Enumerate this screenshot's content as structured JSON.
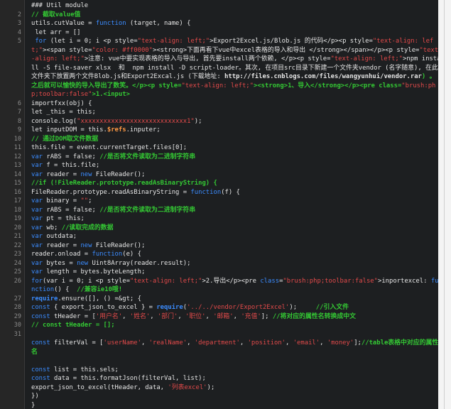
{
  "editor": {
    "lines": [
      {
        "n": "",
        "tokens": [
          {
            "t": "### Util module",
            "c": "plain"
          }
        ]
      },
      {
        "n": "2",
        "tokens": [
          {
            "t": "// 截取value值",
            "c": "com"
          }
        ]
      },
      {
        "n": "3",
        "tokens": [
          {
            "t": "utils.cutValue = ",
            "c": "plain"
          },
          {
            "t": "function",
            "c": "kw"
          },
          {
            "t": " (target, name) {",
            "c": "plain"
          }
        ]
      },
      {
        "n": "4",
        "tokens": [
          {
            "t": " let arr = []",
            "c": "plain"
          }
        ]
      },
      {
        "n": "5",
        "tokens": [
          {
            "t": " for",
            "c": "kw"
          },
          {
            "t": " (let i = 0; i <p style=",
            "c": "plain"
          },
          {
            "t": "\"text-align: left;\"",
            "c": "str"
          },
          {
            "t": ">Export2Excel.js/Blob.js 的代码</p><p style=",
            "c": "plain"
          },
          {
            "t": "\"text-align: left;\"",
            "c": "str"
          },
          {
            "t": "><span style=",
            "c": "plain"
          },
          {
            "t": "\"color: #ff0000\"",
            "c": "str"
          },
          {
            "t": "><strong>下面再看下vue中excel表格的导入和导出 </strong></span></p><p style=",
            "c": "plain"
          },
          {
            "t": "\"text-align: left;\"",
            "c": "str"
          },
          {
            "t": ">注意: vue中要实现表格的导入与导出, 首先要install两个依赖, </p><p style=",
            "c": "plain"
          },
          {
            "t": "\"text-align: left;\"",
            "c": "str"
          },
          {
            "t": ">npm install -S file-saver xlsx  和  npm install -D script-loader。其次, 在项目src目录下新建一个文件夹vendor (名字随意), 在此文件夹下放置两个文件Blob.js和Export2Excal.js (下载地址: ",
            "c": "plain"
          },
          {
            "t": "http://files.cnblogs.com/files/wangyunhui/vendor.rar",
            "c": "link"
          },
          {
            "t": ") 。之后就可以愉快的导入导出了数笑。</p><p style=",
            "c": "com"
          },
          {
            "t": "\"text-align: left;\"",
            "c": "str"
          },
          {
            "t": "><strong>1、导入</strong></p><pre class=",
            "c": "com"
          },
          {
            "t": "\"brush:php;toolbar:false\"",
            "c": "str"
          },
          {
            "t": ">1.<input>",
            "c": "com"
          }
        ]
      },
      {
        "n": "6",
        "tokens": [
          {
            "t": "importfxx(obj) {",
            "c": "plain"
          }
        ]
      },
      {
        "n": "7",
        "tokens": [
          {
            "t": "let _this = this;",
            "c": "plain"
          }
        ]
      },
      {
        "n": "8",
        "tokens": [
          {
            "t": "console.log(",
            "c": "plain"
          },
          {
            "t": "\"xxxxxxxxxxxxxxxxxxxxxxxxxxxx1\"",
            "c": "str"
          },
          {
            "t": ");",
            "c": "plain"
          }
        ]
      },
      {
        "n": "9",
        "tokens": [
          {
            "t": "let inputDOM = this.",
            "c": "plain"
          },
          {
            "t": "$refs",
            "c": "orange"
          },
          {
            "t": ".inputer;",
            "c": "plain"
          }
        ]
      },
      {
        "n": "10",
        "tokens": [
          {
            "t": "// 通过DOM取文件数据",
            "c": "com"
          }
        ]
      },
      {
        "n": "11",
        "tokens": [
          {
            "t": "this.file = event.currentTarget.files[0];",
            "c": "plain"
          }
        ]
      },
      {
        "n": "12",
        "tokens": [
          {
            "t": "var",
            "c": "kw"
          },
          {
            "t": " rABS = false; ",
            "c": "plain"
          },
          {
            "t": "//是否将文件读取为二进制字符串",
            "c": "com"
          }
        ]
      },
      {
        "n": "13",
        "tokens": [
          {
            "t": "var",
            "c": "kw"
          },
          {
            "t": " f = this.file;",
            "c": "plain"
          }
        ]
      },
      {
        "n": "14",
        "tokens": [
          {
            "t": "var",
            "c": "kw"
          },
          {
            "t": " reader = ",
            "c": "plain"
          },
          {
            "t": "new",
            "c": "kw"
          },
          {
            "t": " FileReader();",
            "c": "plain"
          }
        ]
      },
      {
        "n": "15",
        "tokens": [
          {
            "t": "//if (!FileReader.prototype.readAsBinaryString) {",
            "c": "com"
          }
        ]
      },
      {
        "n": "16",
        "tokens": [
          {
            "t": "FileReader.prototype.readAsBinaryString = ",
            "c": "plain"
          },
          {
            "t": "function",
            "c": "kw"
          },
          {
            "t": "(f) {",
            "c": "plain"
          }
        ]
      },
      {
        "n": "17",
        "tokens": [
          {
            "t": "var",
            "c": "kw"
          },
          {
            "t": " binary = ",
            "c": "plain"
          },
          {
            "t": "\"\"",
            "c": "str"
          },
          {
            "t": ";",
            "c": "plain"
          }
        ]
      },
      {
        "n": "18",
        "tokens": [
          {
            "t": "var",
            "c": "kw"
          },
          {
            "t": " rABS = false; ",
            "c": "plain"
          },
          {
            "t": "//是否将文件读取为二进制字符串",
            "c": "com"
          }
        ]
      },
      {
        "n": "19",
        "tokens": [
          {
            "t": "var",
            "c": "kw"
          },
          {
            "t": " pt = this;",
            "c": "plain"
          }
        ]
      },
      {
        "n": "20",
        "tokens": [
          {
            "t": "var",
            "c": "kw"
          },
          {
            "t": " wb; ",
            "c": "plain"
          },
          {
            "t": "//读取完成的数据",
            "c": "com"
          }
        ]
      },
      {
        "n": "21",
        "tokens": [
          {
            "t": "var",
            "c": "kw"
          },
          {
            "t": " outdata;",
            "c": "plain"
          }
        ]
      },
      {
        "n": "22",
        "tokens": [
          {
            "t": "var",
            "c": "kw"
          },
          {
            "t": " reader = ",
            "c": "plain"
          },
          {
            "t": "new",
            "c": "kw"
          },
          {
            "t": " FileReader();",
            "c": "plain"
          }
        ]
      },
      {
        "n": "23",
        "tokens": [
          {
            "t": "reader.onload = ",
            "c": "plain"
          },
          {
            "t": "function",
            "c": "kw"
          },
          {
            "t": "(e) {",
            "c": "plain"
          }
        ]
      },
      {
        "n": "24",
        "tokens": [
          {
            "t": "var",
            "c": "kw"
          },
          {
            "t": " bytes = ",
            "c": "plain"
          },
          {
            "t": "new",
            "c": "kw"
          },
          {
            "t": " Uint8Array(reader.result);",
            "c": "plain"
          }
        ]
      },
      {
        "n": "25",
        "tokens": [
          {
            "t": "var",
            "c": "kw"
          },
          {
            "t": " length = bytes.byteLength;",
            "c": "plain"
          }
        ]
      },
      {
        "n": "26",
        "tokens": [
          {
            "t": "for",
            "c": "kw"
          },
          {
            "t": "(var i = 0; i <p style=",
            "c": "plain"
          },
          {
            "t": "\"text-align: left;\"",
            "c": "str"
          },
          {
            "t": ">2.导出</p><pre ",
            "c": "plain"
          },
          {
            "t": "class",
            "c": "kw"
          },
          {
            "t": "=",
            "c": "plain"
          },
          {
            "t": "\"brush:php;toolbar:false\"",
            "c": "str"
          },
          {
            "t": ">inportexcel: ",
            "c": "plain"
          },
          {
            "t": "function",
            "c": "kw"
          },
          {
            "t": "() {  ",
            "c": "plain"
          },
          {
            "t": "//兼容ie10哦!",
            "c": "com"
          }
        ]
      },
      {
        "n": "27",
        "tokens": [
          {
            "t": "require",
            "c": "kwb"
          },
          {
            "t": ".ensure([], () =&gt; {",
            "c": "plain"
          }
        ]
      },
      {
        "n": "28",
        "tokens": [
          {
            "t": "const",
            "c": "kw"
          },
          {
            "t": " { export_json_to_excel } = ",
            "c": "plain"
          },
          {
            "t": "require",
            "c": "kwb"
          },
          {
            "t": "(",
            "c": "plain"
          },
          {
            "t": "'../../vendor/Export2Excel'",
            "c": "str"
          },
          {
            "t": ");     ",
            "c": "plain"
          },
          {
            "t": "//引入文件",
            "c": "com"
          }
        ]
      },
      {
        "n": "29",
        "tokens": [
          {
            "t": "const",
            "c": "kw"
          },
          {
            "t": " tHeader = [",
            "c": "plain"
          },
          {
            "t": "'用户名'",
            "c": "str"
          },
          {
            "t": ", ",
            "c": "plain"
          },
          {
            "t": "'姓名'",
            "c": "str"
          },
          {
            "t": ", ",
            "c": "plain"
          },
          {
            "t": "'部门'",
            "c": "str"
          },
          {
            "t": ", ",
            "c": "plain"
          },
          {
            "t": "'职位'",
            "c": "str"
          },
          {
            "t": ", ",
            "c": "plain"
          },
          {
            "t": "'邮箱'",
            "c": "str"
          },
          {
            "t": ", ",
            "c": "plain"
          },
          {
            "t": "'充值'",
            "c": "str"
          },
          {
            "t": "]; ",
            "c": "plain"
          },
          {
            "t": "//将对应的属性名转换成中文",
            "c": "com"
          }
        ]
      },
      {
        "n": "30",
        "tokens": [
          {
            "t": "// const tHeader = [];",
            "c": "com"
          }
        ]
      },
      {
        "n": "31",
        "tokens": []
      },
      {
        "n": "",
        "tokens": [
          {
            "t": "const",
            "c": "kw"
          },
          {
            "t": " filterVal = [",
            "c": "plain"
          },
          {
            "t": "'userName'",
            "c": "str"
          },
          {
            "t": ", ",
            "c": "plain"
          },
          {
            "t": "'realName'",
            "c": "str"
          },
          {
            "t": ", ",
            "c": "plain"
          },
          {
            "t": "'department'",
            "c": "str"
          },
          {
            "t": ", ",
            "c": "plain"
          },
          {
            "t": "'position'",
            "c": "str"
          },
          {
            "t": ", ",
            "c": "plain"
          },
          {
            "t": "'email'",
            "c": "str"
          },
          {
            "t": ", ",
            "c": "plain"
          },
          {
            "t": "'money'",
            "c": "str"
          },
          {
            "t": "];",
            "c": "plain"
          },
          {
            "t": "//table表格中对应的属性名",
            "c": "com"
          }
        ]
      },
      {
        "n": "",
        "tokens": []
      },
      {
        "n": "",
        "tokens": [
          {
            "t": "const",
            "c": "kw"
          },
          {
            "t": " list = this.sels;",
            "c": "plain"
          }
        ]
      },
      {
        "n": "",
        "tokens": [
          {
            "t": "const",
            "c": "kw"
          },
          {
            "t": " data = this.formatJson(filterVal, list);",
            "c": "plain"
          }
        ]
      },
      {
        "n": "",
        "tokens": [
          {
            "t": "export_json_to_excel(tHeader, data, ",
            "c": "plain"
          },
          {
            "t": "'列表excel'",
            "c": "str"
          },
          {
            "t": ");",
            "c": "plain"
          }
        ]
      },
      {
        "n": "",
        "tokens": [
          {
            "t": "})",
            "c": "plain"
          }
        ]
      },
      {
        "n": "",
        "tokens": [
          {
            "t": "}",
            "c": "plain"
          }
        ]
      }
    ]
  }
}
